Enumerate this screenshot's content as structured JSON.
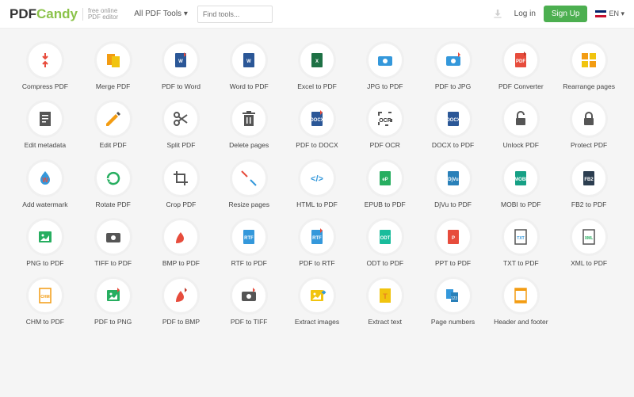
{
  "header": {
    "logo_a": "PDF",
    "logo_b": "Candy",
    "tagline_1": "free online",
    "tagline_2": "PDF editor",
    "dropdown": "All PDF Tools ▾",
    "search_placeholder": "Find tools...",
    "login": "Log in",
    "signup": "Sign Up",
    "lang": "EN ▾"
  },
  "tools": [
    {
      "name": "compress-pdf",
      "label": "Compress PDF",
      "icon": "compress"
    },
    {
      "name": "merge-pdf",
      "label": "Merge PDF",
      "icon": "merge"
    },
    {
      "name": "pdf-to-word",
      "label": "PDF to Word",
      "icon": "word-dl"
    },
    {
      "name": "word-to-pdf",
      "label": "Word to PDF",
      "icon": "word"
    },
    {
      "name": "excel-to-pdf",
      "label": "Excel to PDF",
      "icon": "excel"
    },
    {
      "name": "jpg-to-pdf",
      "label": "JPG to PDF",
      "icon": "camera"
    },
    {
      "name": "pdf-to-jpg",
      "label": "PDF to JPG",
      "icon": "camera-dl"
    },
    {
      "name": "pdf-converter",
      "label": "PDF Converter",
      "icon": "pdf-dl"
    },
    {
      "name": "rearrange-pages",
      "label": "Rearrange pages",
      "icon": "rearrange"
    },
    {
      "name": "edit-metadata",
      "label": "Edit metadata",
      "icon": "metadata"
    },
    {
      "name": "edit-pdf",
      "label": "Edit PDF",
      "icon": "pencil"
    },
    {
      "name": "split-pdf",
      "label": "Split PDF",
      "icon": "scissors"
    },
    {
      "name": "delete-pages",
      "label": "Delete pages",
      "icon": "trash"
    },
    {
      "name": "pdf-to-docx",
      "label": "PDF to DOCX",
      "icon": "docx-dl"
    },
    {
      "name": "pdf-ocr",
      "label": "PDF OCR",
      "icon": "ocr"
    },
    {
      "name": "docx-to-pdf",
      "label": "DOCX to PDF",
      "icon": "docx"
    },
    {
      "name": "unlock-pdf",
      "label": "Unlock PDF",
      "icon": "unlock"
    },
    {
      "name": "protect-pdf",
      "label": "Protect PDF",
      "icon": "lock"
    },
    {
      "name": "add-watermark",
      "label": "Add watermark",
      "icon": "watermark"
    },
    {
      "name": "rotate-pdf",
      "label": "Rotate PDF",
      "icon": "rotate"
    },
    {
      "name": "crop-pdf",
      "label": "Crop PDF",
      "icon": "crop"
    },
    {
      "name": "resize-pages",
      "label": "Resize pages",
      "icon": "resize"
    },
    {
      "name": "html-to-pdf",
      "label": "HTML to PDF",
      "icon": "html"
    },
    {
      "name": "epub-to-pdf",
      "label": "EPUB to PDF",
      "icon": "epub"
    },
    {
      "name": "djvu-to-pdf",
      "label": "DjVu to PDF",
      "icon": "djvu"
    },
    {
      "name": "mobi-to-pdf",
      "label": "MOBI to PDF",
      "icon": "mobi"
    },
    {
      "name": "fb2-to-pdf",
      "label": "FB2 to PDF",
      "icon": "fb2"
    },
    {
      "name": "png-to-pdf",
      "label": "PNG to PDF",
      "icon": "png"
    },
    {
      "name": "tiff-to-pdf",
      "label": "TIFF to PDF",
      "icon": "tiff"
    },
    {
      "name": "bmp-to-pdf",
      "label": "BMP to PDF",
      "icon": "bmp"
    },
    {
      "name": "rtf-to-pdf",
      "label": "RTF to PDF",
      "icon": "rtf"
    },
    {
      "name": "pdf-to-rtf",
      "label": "PDF to RTF",
      "icon": "rtf-dl"
    },
    {
      "name": "odt-to-pdf",
      "label": "ODT to PDF",
      "icon": "odt"
    },
    {
      "name": "ppt-to-pdf",
      "label": "PPT to PDF",
      "icon": "ppt"
    },
    {
      "name": "txt-to-pdf",
      "label": "TXT to PDF",
      "icon": "txt"
    },
    {
      "name": "xml-to-pdf",
      "label": "XML to PDF",
      "icon": "xml"
    },
    {
      "name": "chm-to-pdf",
      "label": "CHM to PDF",
      "icon": "chm"
    },
    {
      "name": "pdf-to-png",
      "label": "PDF to PNG",
      "icon": "png-dl"
    },
    {
      "name": "pdf-to-bmp",
      "label": "PDF to BMP",
      "icon": "bmp-dl"
    },
    {
      "name": "pdf-to-tiff",
      "label": "PDF to TIFF",
      "icon": "tiff-dl"
    },
    {
      "name": "extract-images",
      "label": "Extract images",
      "icon": "extract-img"
    },
    {
      "name": "extract-text",
      "label": "Extract text",
      "icon": "extract-txt"
    },
    {
      "name": "page-numbers",
      "label": "Page numbers",
      "icon": "pagenum"
    },
    {
      "name": "header-footer",
      "label": "Header and footer",
      "icon": "headfoot"
    }
  ]
}
